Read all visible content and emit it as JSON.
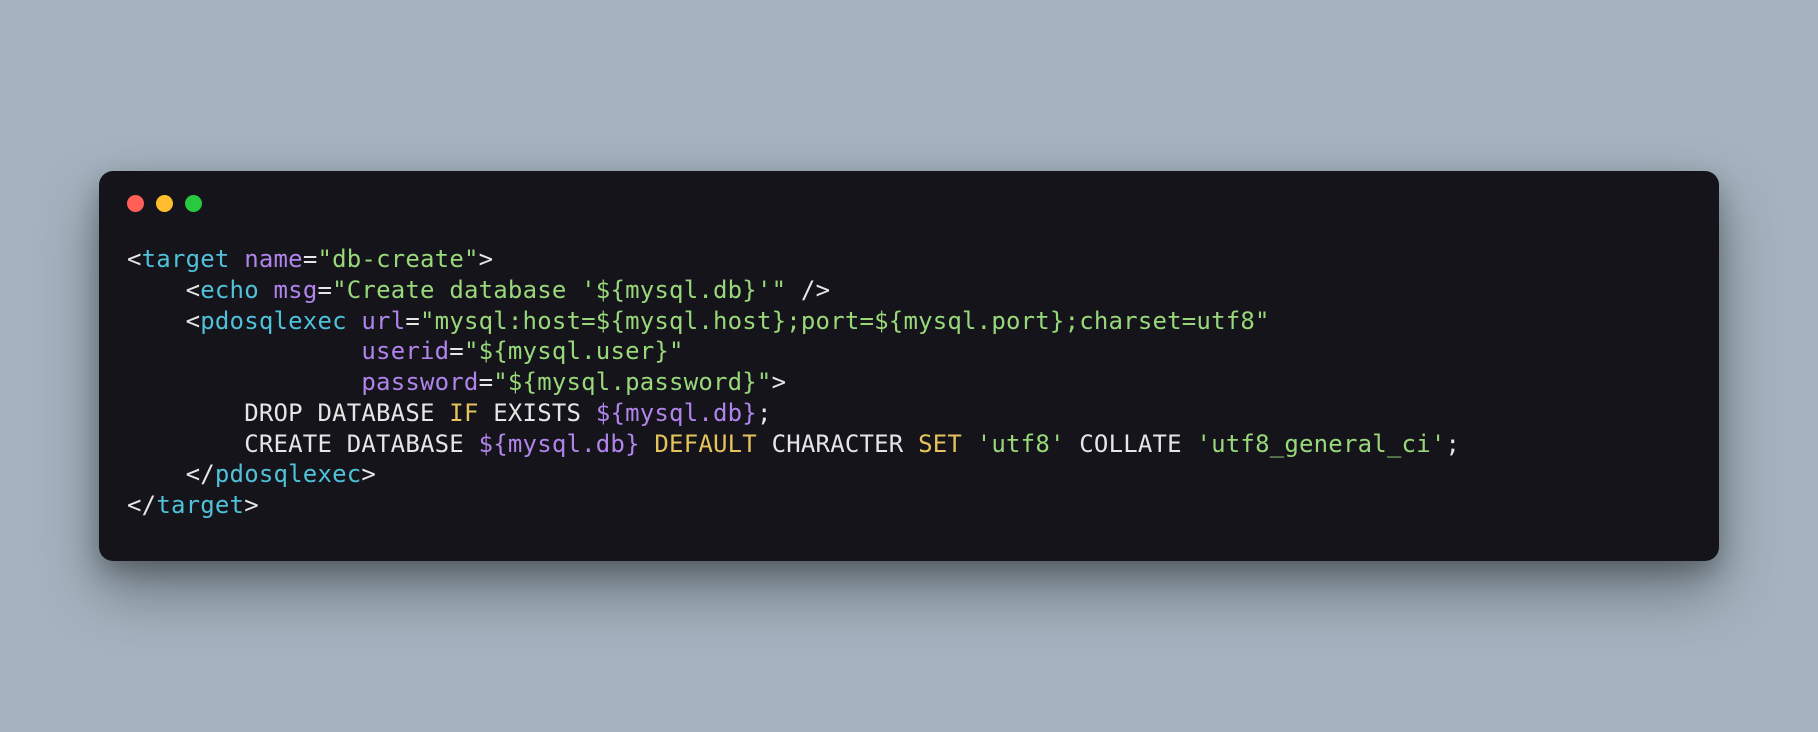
{
  "colors": {
    "bg_page": "#a4b3bf",
    "bg_window": "#14141a",
    "dot_red": "#ff5f56",
    "dot_yellow": "#ffbd2e",
    "dot_green": "#27c93f",
    "punc": "#e6e6e6",
    "tag": "#4fc1d9",
    "attr": "#b084eb",
    "string": "#99d87a",
    "keyword": "#e6c35c",
    "text": "#e6e6e6",
    "interp": "#b084eb"
  },
  "code": {
    "lines": [
      [
        {
          "cls": "t-punc",
          "t": "<"
        },
        {
          "cls": "t-tag",
          "t": "target"
        },
        {
          "cls": "t-punc",
          "t": " "
        },
        {
          "cls": "t-attr",
          "t": "name"
        },
        {
          "cls": "t-eq",
          "t": "="
        },
        {
          "cls": "t-str",
          "t": "\"db-create\""
        },
        {
          "cls": "t-punc",
          "t": ">"
        }
      ],
      [
        {
          "cls": "t-punc",
          "t": "    <"
        },
        {
          "cls": "t-tag",
          "t": "echo"
        },
        {
          "cls": "t-punc",
          "t": " "
        },
        {
          "cls": "t-attr",
          "t": "msg"
        },
        {
          "cls": "t-eq",
          "t": "="
        },
        {
          "cls": "t-str",
          "t": "\"Create database '${mysql.db}'\""
        },
        {
          "cls": "t-punc",
          "t": " />"
        }
      ],
      [
        {
          "cls": "t-punc",
          "t": "    <"
        },
        {
          "cls": "t-tag",
          "t": "pdosqlexec"
        },
        {
          "cls": "t-punc",
          "t": " "
        },
        {
          "cls": "t-attr",
          "t": "url"
        },
        {
          "cls": "t-eq",
          "t": "="
        },
        {
          "cls": "t-str",
          "t": "\"mysql:host=${mysql.host};port=${mysql.port};charset=utf8\""
        }
      ],
      [
        {
          "cls": "t-punc",
          "t": "                "
        },
        {
          "cls": "t-attr",
          "t": "userid"
        },
        {
          "cls": "t-eq",
          "t": "="
        },
        {
          "cls": "t-str",
          "t": "\"${mysql.user}\""
        }
      ],
      [
        {
          "cls": "t-punc",
          "t": "                "
        },
        {
          "cls": "t-attr",
          "t": "password"
        },
        {
          "cls": "t-eq",
          "t": "="
        },
        {
          "cls": "t-str",
          "t": "\"${mysql.password}\""
        },
        {
          "cls": "t-punc",
          "t": ">"
        }
      ],
      [
        {
          "cls": "t-text",
          "t": "        DROP DATABASE "
        },
        {
          "cls": "t-kw",
          "t": "IF"
        },
        {
          "cls": "t-text",
          "t": " EXISTS "
        },
        {
          "cls": "t-interp",
          "t": "${mysql.db}"
        },
        {
          "cls": "t-text",
          "t": ";"
        }
      ],
      [
        {
          "cls": "t-text",
          "t": "        CREATE DATABASE "
        },
        {
          "cls": "t-interp",
          "t": "${mysql.db}"
        },
        {
          "cls": "t-text",
          "t": " "
        },
        {
          "cls": "t-kw",
          "t": "DEFAULT"
        },
        {
          "cls": "t-text",
          "t": " CHARACTER "
        },
        {
          "cls": "t-kw",
          "t": "SET"
        },
        {
          "cls": "t-text",
          "t": " "
        },
        {
          "cls": "t-str",
          "t": "'utf8'"
        },
        {
          "cls": "t-text",
          "t": " COLLATE "
        },
        {
          "cls": "t-str",
          "t": "'utf8_general_ci'"
        },
        {
          "cls": "t-text",
          "t": ";"
        }
      ],
      [
        {
          "cls": "t-punc",
          "t": "    </"
        },
        {
          "cls": "t-tag",
          "t": "pdosqlexec"
        },
        {
          "cls": "t-punc",
          "t": ">"
        }
      ],
      [
        {
          "cls": "t-punc",
          "t": "</"
        },
        {
          "cls": "t-tag",
          "t": "target"
        },
        {
          "cls": "t-punc",
          "t": ">"
        }
      ]
    ]
  }
}
